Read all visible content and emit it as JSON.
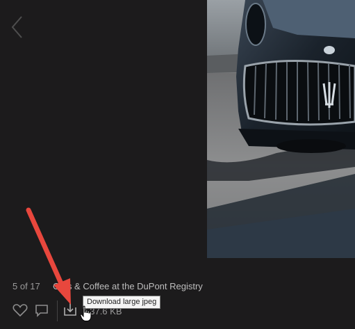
{
  "viewer": {
    "counter": "5 of 17",
    "album_title": "Cars & Coffee at the DuPont Registry",
    "file_size": "537.6 KB",
    "tooltip": "Download large jpeg"
  },
  "icons": {
    "back": "chevron-left-icon",
    "like": "heart-icon",
    "comment": "comment-icon",
    "download": "download-icon",
    "cursor": "hand-cursor-icon"
  },
  "colors": {
    "background": "#1c1b1c",
    "annotation_arrow": "#e8473d",
    "icon_gray": "#8e8e8e"
  }
}
